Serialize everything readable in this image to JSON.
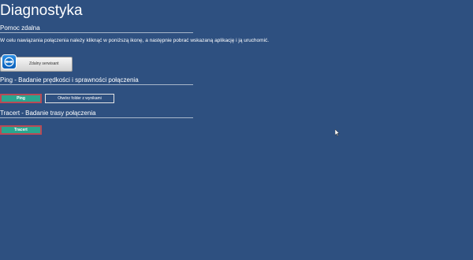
{
  "page": {
    "title": "Diagnostyka"
  },
  "remote_help": {
    "heading": "Pomoc zdalna",
    "description": "W celu nawiązania połączenia należy kliknąć w poniższą ikonę, a następnie pobrać wskazaną aplikację i ją uruchomić.",
    "button_label": "Zdalny serwisant",
    "icon": "teamviewer-icon"
  },
  "ping": {
    "heading": "Ping - Badanie prędkości i sprawności połączenia",
    "ping_button_label": "Ping",
    "folder_button_label": "Otwórz folder z wynikami"
  },
  "tracert": {
    "heading": "Tracert - Badanie trasy połączenia",
    "button_label": "Tracert"
  },
  "colors": {
    "background": "#2e5080",
    "accent_button": "#2aa68f",
    "button_outline": "#b94a56"
  }
}
